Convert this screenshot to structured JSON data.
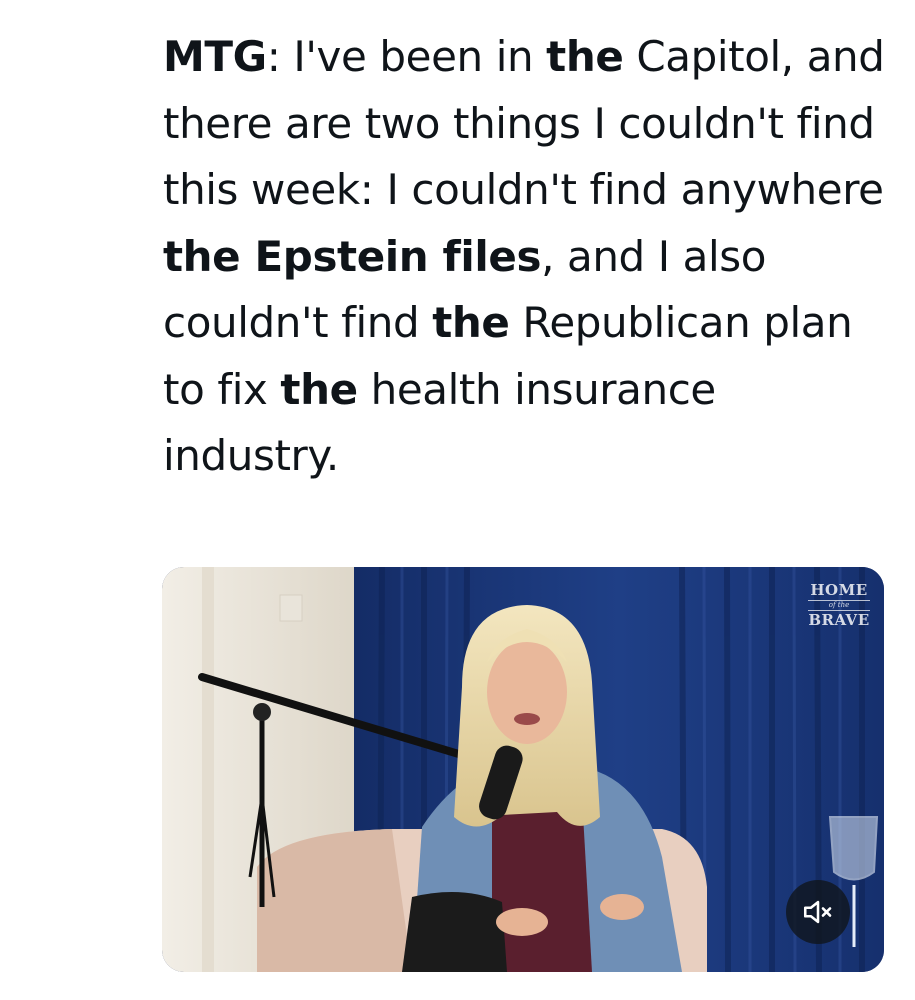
{
  "tweet": {
    "segments": [
      {
        "text": "MTG",
        "bold": true
      },
      {
        "text": ": I've been in ",
        "bold": false
      },
      {
        "text": "the",
        "bold": true
      },
      {
        "text": " Capitol, and there are two things I couldn't find this week: I couldn't find anywhere ",
        "bold": false
      },
      {
        "text": "the Epstein files",
        "bold": true
      },
      {
        "text": ", and I also couldn't find ",
        "bold": false
      },
      {
        "text": "the",
        "bold": true
      },
      {
        "text": " Republican plan to fix ",
        "bold": false
      },
      {
        "text": "the",
        "bold": true
      },
      {
        "text": " health insurance industry.",
        "bold": false
      }
    ]
  },
  "video": {
    "watermark": {
      "line1": "HOME",
      "line2": "of the",
      "line3": "BRAVE"
    },
    "mute_icon": "volume-muted-icon",
    "colors": {
      "curtain": "#1c3a80",
      "wall": "#ece7dc",
      "chair": "#e8cfc0"
    }
  }
}
